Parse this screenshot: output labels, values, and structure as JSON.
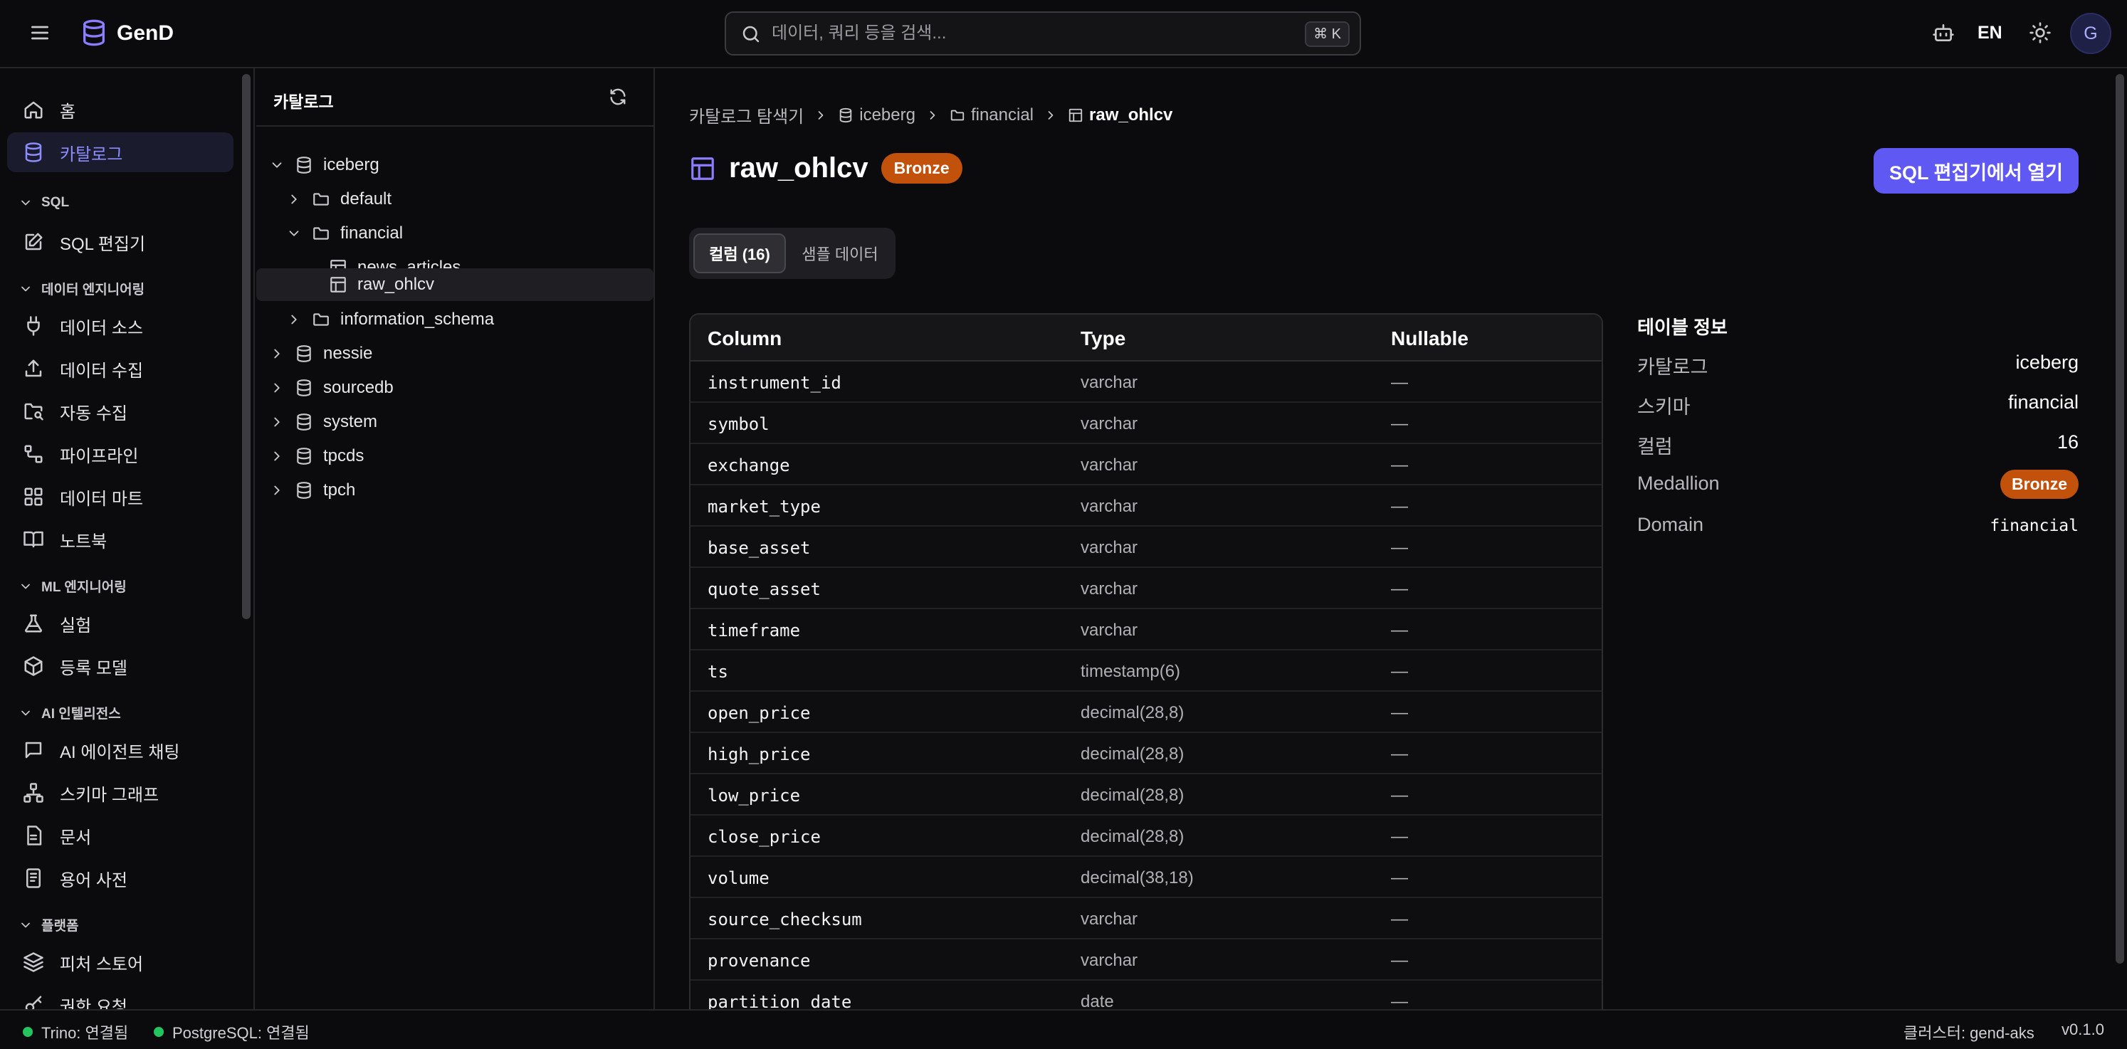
{
  "header": {
    "app_name": "GenD",
    "search_placeholder": "데이터, 쿼리 등을 검색...",
    "search_shortcut": "⌘ K",
    "language": "EN",
    "avatar_initial": "G"
  },
  "sidebar": {
    "items": [
      {
        "label": "홈",
        "icon": "home-icon"
      },
      {
        "label": "카탈로그",
        "icon": "database-icon",
        "active": true
      }
    ],
    "sections": [
      {
        "title": "SQL",
        "items": [
          {
            "label": "SQL 편집기",
            "icon": "edit-icon"
          }
        ]
      },
      {
        "title": "데이터 엔지니어링",
        "items": [
          {
            "label": "데이터 소스",
            "icon": "plug-icon"
          },
          {
            "label": "데이터 수집",
            "icon": "upload-icon"
          },
          {
            "label": "자동 수집",
            "icon": "folder-search-icon"
          },
          {
            "label": "파이프라인",
            "icon": "pipeline-icon"
          },
          {
            "label": "데이터 마트",
            "icon": "grid-icon"
          },
          {
            "label": "노트북",
            "icon": "book-icon"
          }
        ]
      },
      {
        "title": "ML 엔지니어링",
        "items": [
          {
            "label": "실험",
            "icon": "flask-icon"
          },
          {
            "label": "등록 모델",
            "icon": "box-icon"
          }
        ]
      },
      {
        "title": "AI 인텔리전스",
        "items": [
          {
            "label": "AI 에이전트 채팅",
            "icon": "chat-icon"
          },
          {
            "label": "스키마 그래프",
            "icon": "graph-icon"
          },
          {
            "label": "문서",
            "icon": "document-icon"
          },
          {
            "label": "용어 사전",
            "icon": "glossary-icon"
          }
        ]
      },
      {
        "title": "플랫폼",
        "items": [
          {
            "label": "피처 스토어",
            "icon": "layers-icon"
          },
          {
            "label": "권한 요청",
            "icon": "key-icon"
          }
        ]
      }
    ]
  },
  "catalog_tree": {
    "title": "카탈로그",
    "nodes": [
      {
        "label": "iceberg",
        "type": "database",
        "depth": 0,
        "expanded": true
      },
      {
        "label": "default",
        "type": "folder",
        "depth": 1,
        "expanded": false
      },
      {
        "label": "financial",
        "type": "folder",
        "depth": 1,
        "expanded": true
      },
      {
        "label": "news_articles",
        "type": "table",
        "depth": 2
      },
      {
        "label": "raw_ohlcv",
        "type": "table",
        "depth": 2,
        "selected": true
      },
      {
        "label": "information_schema",
        "type": "folder",
        "depth": 1,
        "expanded": false
      },
      {
        "label": "nessie",
        "type": "database",
        "depth": 0,
        "expanded": false
      },
      {
        "label": "sourcedb",
        "type": "database",
        "depth": 0,
        "expanded": false
      },
      {
        "label": "system",
        "type": "database",
        "depth": 0,
        "expanded": false
      },
      {
        "label": "tpcds",
        "type": "database",
        "depth": 0,
        "expanded": false
      },
      {
        "label": "tpch",
        "type": "database",
        "depth": 0,
        "expanded": false
      }
    ]
  },
  "main": {
    "breadcrumb": [
      "카탈로그 탐색기",
      "iceberg",
      "financial",
      "raw_ohlcv"
    ],
    "title": "raw_ohlcv",
    "medallion_badge": "Bronze",
    "open_sql_label": "SQL 편집기에서 열기",
    "tabs": [
      {
        "label": "컬럼 (16)",
        "active": true
      },
      {
        "label": "샘플 데이터",
        "active": false
      }
    ],
    "table": {
      "headers": [
        "Column",
        "Type",
        "Nullable"
      ],
      "rows": [
        [
          "instrument_id",
          "varchar",
          "—"
        ],
        [
          "symbol",
          "varchar",
          "—"
        ],
        [
          "exchange",
          "varchar",
          "—"
        ],
        [
          "market_type",
          "varchar",
          "—"
        ],
        [
          "base_asset",
          "varchar",
          "—"
        ],
        [
          "quote_asset",
          "varchar",
          "—"
        ],
        [
          "timeframe",
          "varchar",
          "—"
        ],
        [
          "ts",
          "timestamp(6)",
          "—"
        ],
        [
          "open_price",
          "decimal(28,8)",
          "—"
        ],
        [
          "high_price",
          "decimal(28,8)",
          "—"
        ],
        [
          "low_price",
          "decimal(28,8)",
          "—"
        ],
        [
          "close_price",
          "decimal(28,8)",
          "—"
        ],
        [
          "volume",
          "decimal(38,18)",
          "—"
        ],
        [
          "source_checksum",
          "varchar",
          "—"
        ],
        [
          "provenance",
          "varchar",
          "—"
        ],
        [
          "partition_date",
          "date",
          "—"
        ]
      ]
    },
    "table_info": {
      "title": "테이블 정보",
      "rows": [
        {
          "key": "카탈로그",
          "value": "iceberg"
        },
        {
          "key": "스키마",
          "value": "financial"
        },
        {
          "key": "컬럼",
          "value": "16"
        },
        {
          "key": "Medallion",
          "value": "Bronze",
          "badge": true
        },
        {
          "key": "Domain",
          "value": "financial",
          "mono": true
        }
      ]
    }
  },
  "statusbar": {
    "trino": "Trino: 연결됨",
    "postgres": "PostgreSQL: 연결됨",
    "cluster": "클러스터: gend-aks",
    "version": "v0.1.0"
  },
  "colors": {
    "accent": "#6058f2",
    "bronze": "#c2510c",
    "connected": "#22c55e"
  }
}
